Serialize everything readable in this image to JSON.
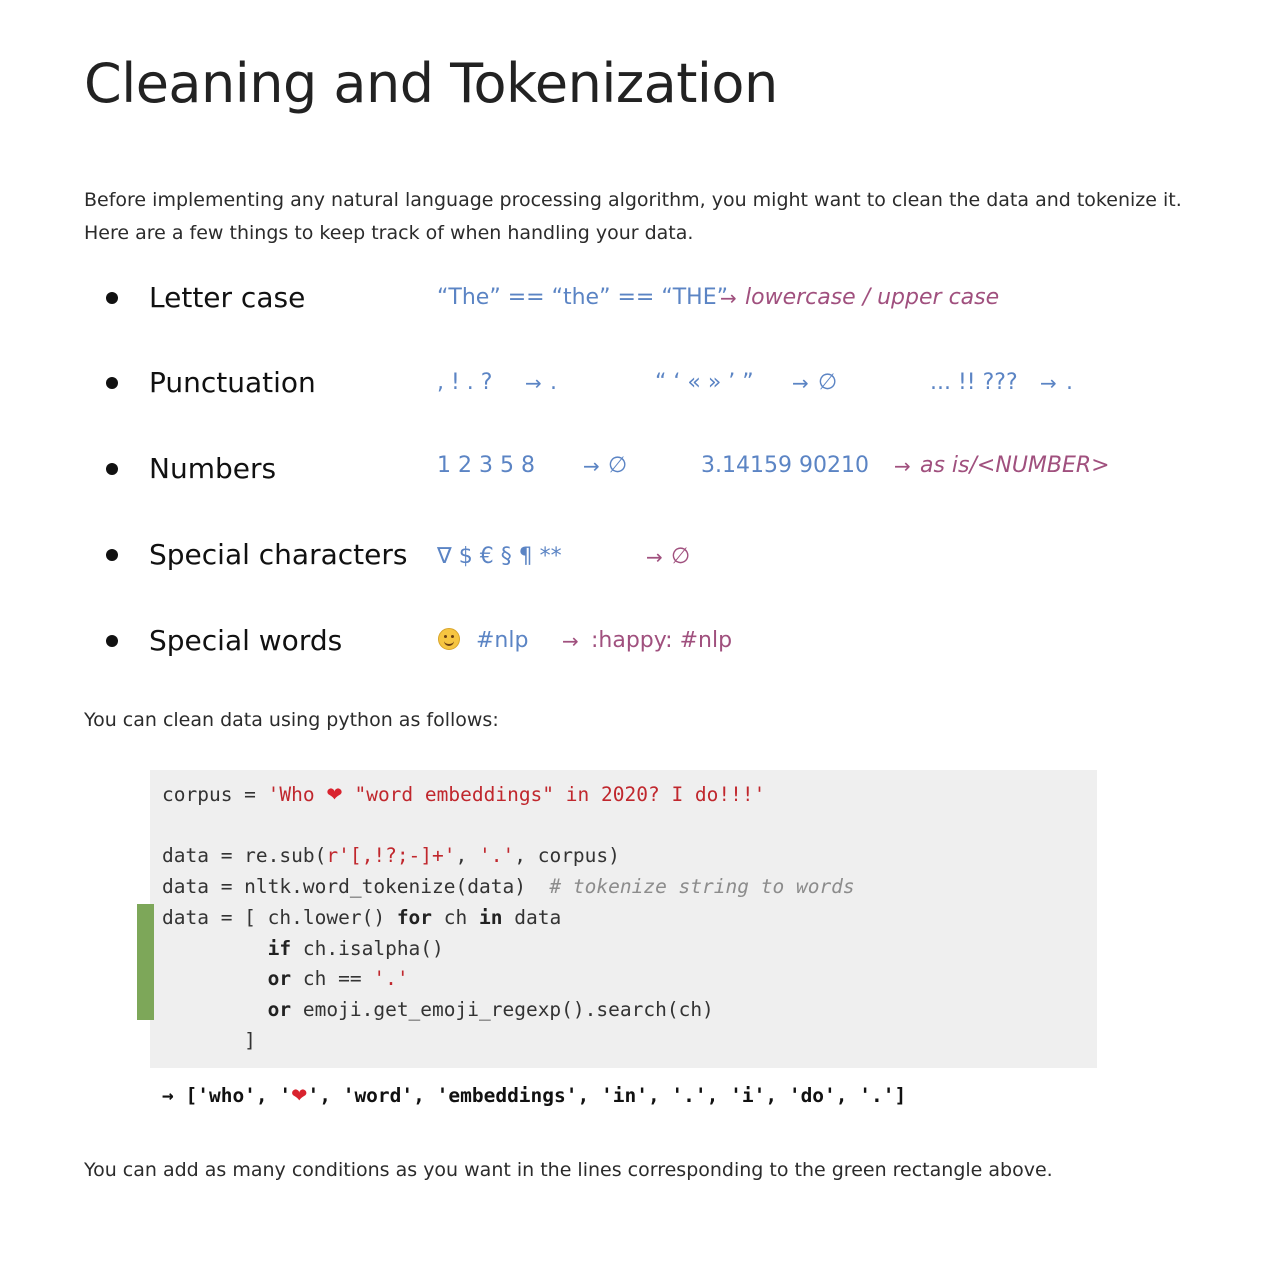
{
  "title": "Cleaning and Tokenization",
  "intro": {
    "line1": "Before implementing any natural language processing algorithm, you might want to clean the data and tokenize it.",
    "line2": "Here are a few things to keep track of when handling your data."
  },
  "bullets": {
    "letter_case": {
      "term": "Letter case",
      "example": "“The” == “the” == “THE”",
      "arrow": "→",
      "result": "lowercase / upper case"
    },
    "punctuation": {
      "term": "Punctuation",
      "group1": ", ! . ?",
      "arrow1": "→",
      "result1": ".",
      "group2": "“ ‘ « » ’ ”",
      "arrow2": "→",
      "result2": "∅",
      "group3": "... !! ???",
      "arrow3": "→",
      "result3": "."
    },
    "numbers": {
      "term": "Numbers",
      "group1": "1 2 3 5 8",
      "arrow1": "→",
      "result1": "∅",
      "group2": "3.14159 90210",
      "arrow2": "→",
      "result2": "as is/<NUMBER>"
    },
    "special_characters": {
      "term": "Special characters",
      "group": "∇ $ € § ¶ **",
      "arrow": "→",
      "result": "∅"
    },
    "special_words": {
      "term": "Special words",
      "emoji_icon": "smiley-face-emoji",
      "hashtag": "#nlp",
      "arrow": "→",
      "result": ":happy: #nlp"
    }
  },
  "python_intro": "You can clean data using python as follows:",
  "code": {
    "line1": {
      "a": "corpus = ",
      "str1": "'Who ",
      "heart": "❤",
      "str2": " \"word embeddings\" in 2020? I do!!!'"
    },
    "line3": {
      "a": "data = re.sub(",
      "str1": "r'[,!?;-]+'",
      "b": ", ",
      "str2": "'.'",
      "c": ", corpus)"
    },
    "line4": {
      "a": "data = nltk.word_tokenize(data)  ",
      "comment": "# tokenize string to words"
    },
    "line5": {
      "a": "data = [ ch.lower() ",
      "kw1": "for",
      "b": " ch ",
      "kw2": "in",
      "c": " data"
    },
    "line6": {
      "indent": "         ",
      "kw": "if",
      "b": " ch.isalpha()"
    },
    "line7": {
      "indent": "         ",
      "kw": "or",
      "b": " ch == ",
      "str": "'.'"
    },
    "line8": {
      "indent": "         ",
      "kw": "or",
      "b": " emoji.get_emoji_regexp().search(ch)"
    },
    "line9": "       ]",
    "highlight_color": "#7da759"
  },
  "output": {
    "prefix": "→ ['who', '",
    "heart": "❤",
    "suffix": "', 'word', 'embeddings', 'in', '.', 'i', 'do', '.']"
  },
  "outro": "You can add as many conditions as you want in the lines corresponding to the green rectangle above."
}
